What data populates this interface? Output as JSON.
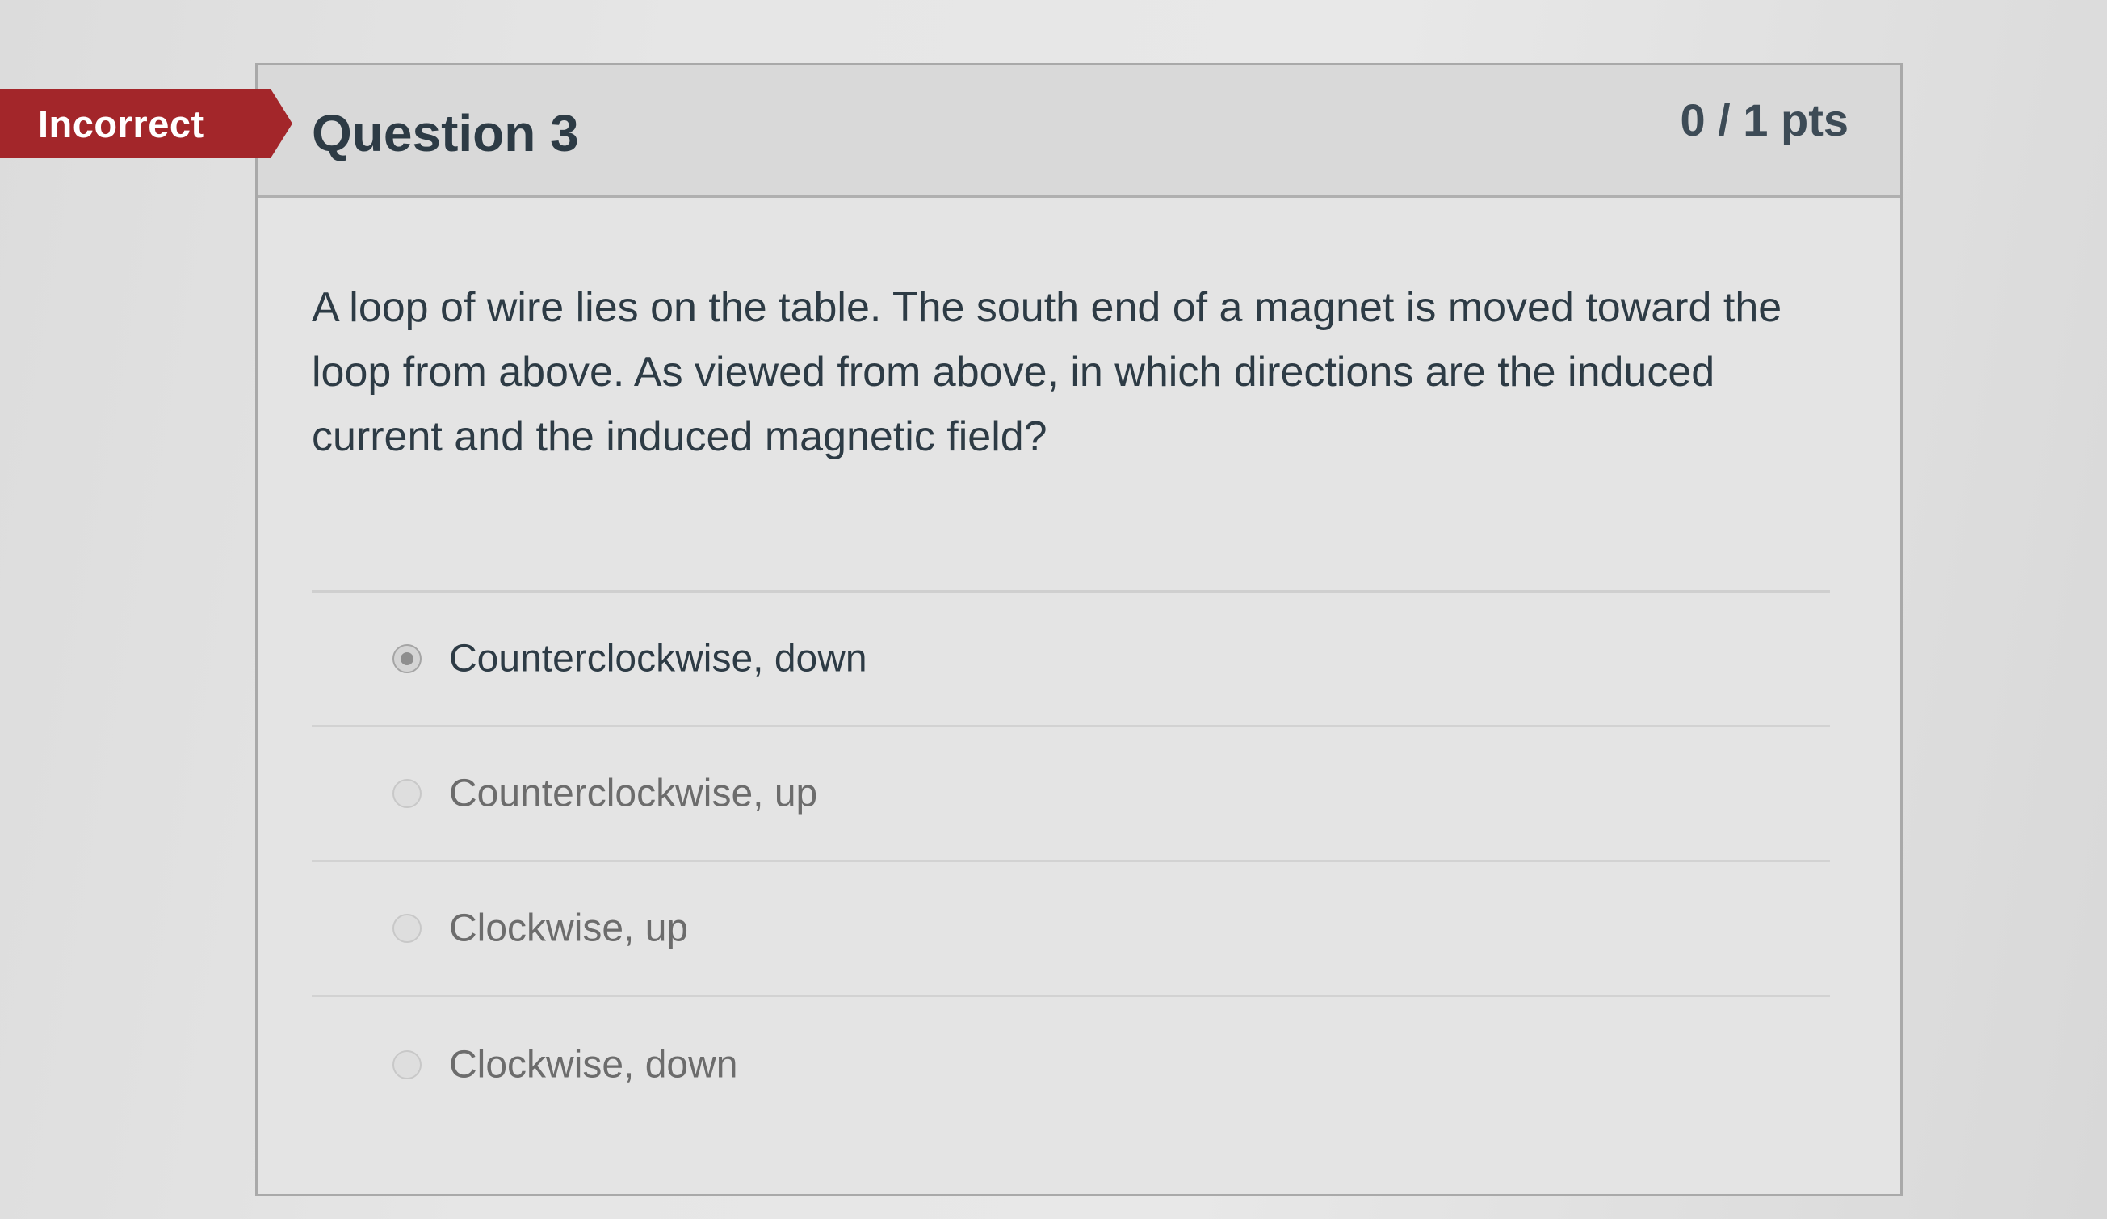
{
  "status": {
    "label": "Incorrect",
    "color": "#a3262a"
  },
  "question": {
    "title": "Question 3",
    "points": "0 / 1 pts",
    "text": "A loop of wire lies on the table. The south end of a magnet is moved toward the loop from above. As viewed from above, in which directions are the induced current and the induced magnetic field?"
  },
  "answers": [
    {
      "label": "Counterclockwise, down",
      "selected": true
    },
    {
      "label": "Counterclockwise, up",
      "selected": false
    },
    {
      "label": "Clockwise, up",
      "selected": false
    },
    {
      "label": "Clockwise, down",
      "selected": false
    }
  ],
  "icons": {
    "radio": "radio-button-icon"
  }
}
